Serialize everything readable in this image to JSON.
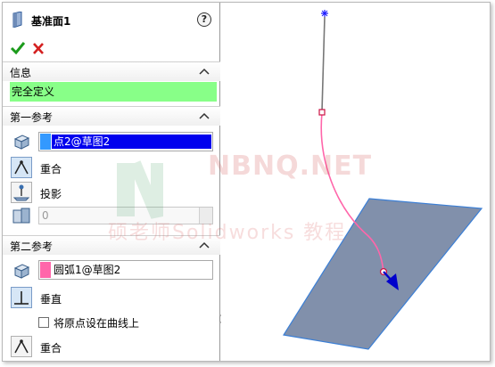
{
  "feature": {
    "title": "基准面1",
    "help_icon_text": "?"
  },
  "actions": {
    "ok_icon": "check-icon",
    "cancel_icon": "close-icon"
  },
  "info_section": {
    "header": "信息",
    "status": "完全定义",
    "status_color": "#88ff88"
  },
  "first_reference": {
    "header": "第一参考",
    "value": "点2@草图2",
    "highlight_color": "#0000ee",
    "swatch_color": "#3399ff",
    "options": [
      {
        "label": "重合",
        "icon": "coincident-icon"
      },
      {
        "label": "投影",
        "icon": "projection-icon"
      }
    ],
    "spin_value": "0"
  },
  "second_reference": {
    "header": "第二参考",
    "value": "圆弧1@草图2",
    "swatch_color": "#ff66aa",
    "options": [
      {
        "label": "垂直",
        "icon": "perpendicular-icon"
      }
    ],
    "checkbox_label": "将原点设在曲线上",
    "checkbox_checked": false,
    "last_option": {
      "label": "重合",
      "icon": "coincident-icon"
    }
  },
  "watermark": {
    "site": "NBNQ.NET",
    "subtitle": "硕老师Solidworks 教程"
  },
  "colors": {
    "plane_fill": "#7a8aa6",
    "plane_edge": "#3b7fd6",
    "curve": "#ff66aa",
    "line": "#777777",
    "arrow": "#0000cc"
  }
}
